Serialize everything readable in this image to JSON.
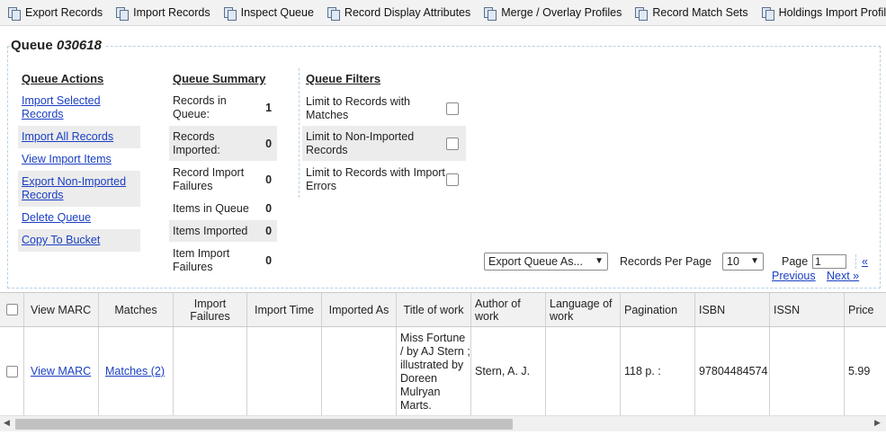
{
  "toolbar": [
    {
      "label": "Export Records",
      "icon": "copy-icon"
    },
    {
      "label": "Import Records",
      "icon": "copy-icon"
    },
    {
      "label": "Inspect Queue",
      "icon": "copy-icon"
    },
    {
      "label": "Record Display Attributes",
      "icon": "copy-icon"
    },
    {
      "label": "Merge / Overlay Profiles",
      "icon": "copy-icon"
    },
    {
      "label": "Record Match Sets",
      "icon": "copy-icon"
    },
    {
      "label": "Holdings Import Profiles",
      "icon": "copy-icon"
    }
  ],
  "queue": {
    "label": "Queue",
    "id": "030618"
  },
  "actions": {
    "title": "Queue Actions",
    "items": [
      "Import Selected Records",
      "Import All Records",
      "View Import Items",
      "Export Non-Imported Records",
      "Delete Queue",
      "Copy To Bucket"
    ]
  },
  "summary": {
    "title": "Queue Summary",
    "rows": [
      {
        "label": "Records in Queue:",
        "value": "1"
      },
      {
        "label": "Records Imported:",
        "value": "0"
      },
      {
        "label": "Record Import Failures",
        "value": "0"
      },
      {
        "label": "Items in Queue",
        "value": "0"
      },
      {
        "label": "Items Imported",
        "value": "0"
      },
      {
        "label": "Item Import Failures",
        "value": "0"
      }
    ]
  },
  "filters": {
    "title": "Queue Filters",
    "rows": [
      {
        "label": "Limit to Records with Matches",
        "checked": false
      },
      {
        "label": "Limit to Non-Imported Records",
        "checked": false
      },
      {
        "label": "Limit to Records with Import Errors",
        "checked": false
      }
    ]
  },
  "controls": {
    "export_select": "Export Queue As...",
    "records_per_page_label": "Records Per Page",
    "records_per_page_value": "10",
    "page_label": "Page",
    "page_value": "1",
    "first_link": "«",
    "prev_link": "Previous",
    "next_link": "Next »"
  },
  "table": {
    "columns": [
      "View MARC",
      "Matches",
      "Import Failures",
      "Import Time",
      "Imported As",
      "Title of work",
      "Author of work",
      "Language of work",
      "Pagination",
      "ISBN",
      "ISSN",
      "Price"
    ],
    "rows": [
      {
        "view_marc": "View MARC",
        "matches": "Matches (2)",
        "import_failures": "",
        "import_time": "",
        "imported_as": "",
        "title": "Miss Fortune / by AJ Stern ; illustrated by Doreen Mulryan Marts.",
        "author": "Stern, A. J.",
        "language": "",
        "pagination": "118 p. :",
        "isbn": "97804484574",
        "issn": "",
        "price": "5.99"
      }
    ]
  },
  "colors": {
    "link": "#1a3fc2",
    "panel_border": "#b7d0e4",
    "header_bg": "#f1f1f1",
    "shade": "#ececec"
  }
}
